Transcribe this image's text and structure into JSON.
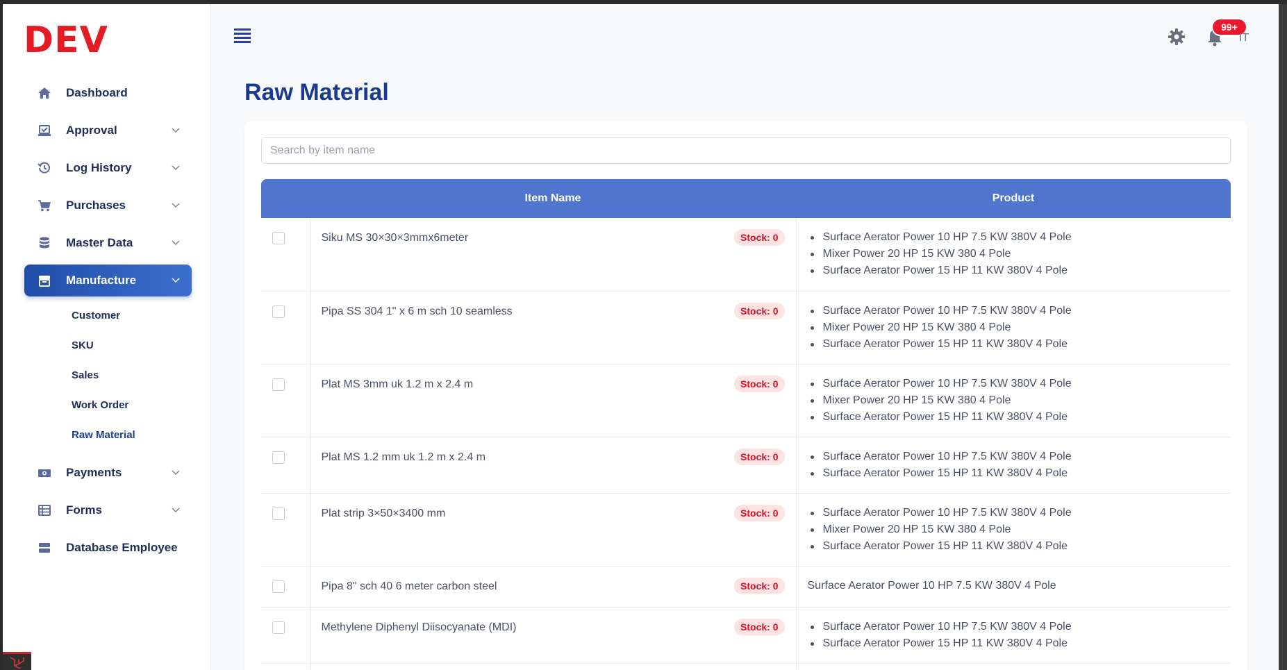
{
  "brand": "DEV",
  "sidebar": {
    "items": [
      {
        "label": "Dashboard",
        "icon": "home-icon",
        "chevron": false
      },
      {
        "label": "Approval",
        "icon": "approval-icon",
        "chevron": true
      },
      {
        "label": "Log History",
        "icon": "history-icon",
        "chevron": true
      },
      {
        "label": "Purchases",
        "icon": "cart-icon",
        "chevron": true
      },
      {
        "label": "Master Data",
        "icon": "database-icon",
        "chevron": true
      },
      {
        "label": "Manufacture",
        "icon": "store-icon",
        "chevron": true,
        "active": true
      },
      {
        "label": "Payments",
        "icon": "money-icon",
        "chevron": true
      },
      {
        "label": "Forms",
        "icon": "table-icon",
        "chevron": true
      },
      {
        "label": "Database Employee",
        "icon": "server-icon",
        "chevron": false
      }
    ],
    "manufacture_sub": [
      "Customer",
      "SKU",
      "Sales",
      "Work Order",
      "Raw Material"
    ]
  },
  "topbar": {
    "notification_count": "99+",
    "avatar_text": "IT"
  },
  "page": {
    "title": "Raw Material",
    "search_placeholder": "Search by item name"
  },
  "table": {
    "headers": [
      "",
      "Item Name",
      "Product"
    ],
    "rows": [
      {
        "name": "Siku MS 30×30×3mmx6meter",
        "stock": "Stock: 0",
        "products": [
          "Surface Aerator Power 10 HP 7.5 KW 380V 4 Pole",
          "Mixer Power 20 HP 15 KW 380 4 Pole",
          "Surface Aerator Power 15 HP 11 KW 380V 4 Pole"
        ]
      },
      {
        "name": "Pipa SS 304 1\" x 6 m sch 10 seamless",
        "stock": "Stock: 0",
        "products": [
          "Surface Aerator Power 10 HP 7.5 KW 380V 4 Pole",
          "Mixer Power 20 HP 15 KW 380 4 Pole",
          "Surface Aerator Power 15 HP 11 KW 380V 4 Pole"
        ]
      },
      {
        "name": "Plat MS 3mm uk 1.2 m x 2.4 m",
        "stock": "Stock: 0",
        "products": [
          "Surface Aerator Power 10 HP 7.5 KW 380V 4 Pole",
          "Mixer Power 20 HP 15 KW 380 4 Pole",
          "Surface Aerator Power 15 HP 11 KW 380V 4 Pole"
        ]
      },
      {
        "name": "Plat MS 1.2 mm uk 1.2 m x 2.4 m",
        "stock": "Stock: 0",
        "products": [
          "Surface Aerator Power 10 HP 7.5 KW 380V 4 Pole",
          "Surface Aerator Power 15 HP 11 KW 380V 4 Pole"
        ]
      },
      {
        "name": "Plat strip 3×50×3400 mm",
        "stock": "Stock: 0",
        "products": [
          "Surface Aerator Power 10 HP 7.5 KW 380V 4 Pole",
          "Mixer Power 20 HP 15 KW 380 4 Pole",
          "Surface Aerator Power 15 HP 11 KW 380V 4 Pole"
        ]
      },
      {
        "name": "Pipa 8\" sch 40 6 meter carbon steel",
        "stock": "Stock: 0",
        "products": [
          "Surface Aerator Power 10 HP 7.5 KW 380V 4 Pole"
        ],
        "plain": true
      },
      {
        "name": "Methylene Diphenyl Diisocyanate (MDI)",
        "stock": "Stock: 0",
        "products": [
          "Surface Aerator Power 10 HP 7.5 KW 380V 4 Pole",
          "Surface Aerator Power 15 HP 11 KW 380V 4 Pole"
        ]
      }
    ]
  }
}
